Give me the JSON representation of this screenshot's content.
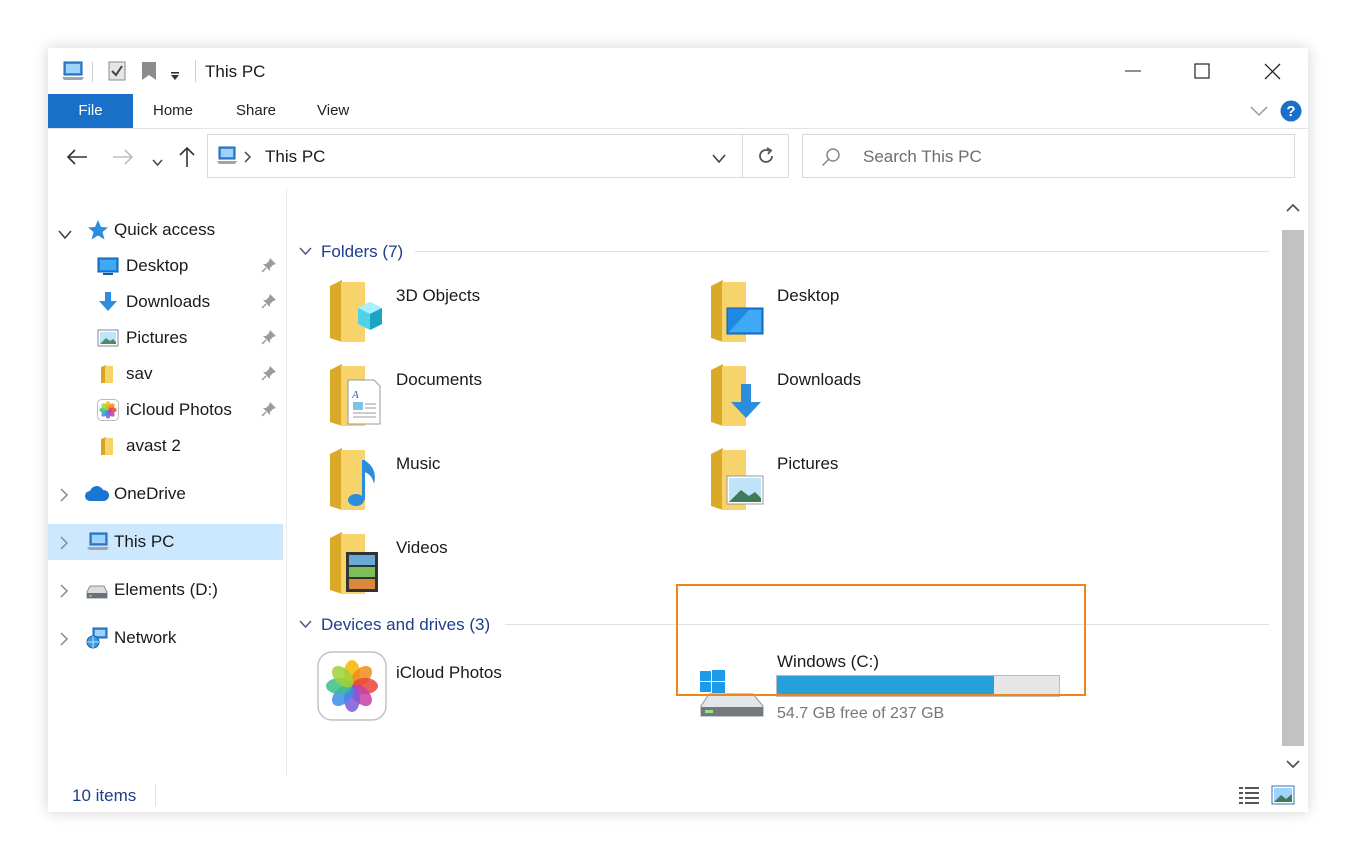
{
  "window": {
    "title": "This PC"
  },
  "ribbon": {
    "tabs": [
      "File",
      "Home",
      "Share",
      "View"
    ]
  },
  "address": {
    "path": "This PC",
    "search_placeholder": "Search This PC"
  },
  "sidebar": {
    "quick_access": "Quick access",
    "quick_items": [
      {
        "label": "Desktop",
        "icon": "desktop-icon",
        "pinned": true
      },
      {
        "label": "Downloads",
        "icon": "downloads-icon",
        "pinned": true
      },
      {
        "label": "Pictures",
        "icon": "pictures-icon",
        "pinned": true
      },
      {
        "label": "sav",
        "icon": "folder-icon",
        "pinned": true
      },
      {
        "label": "iCloud Photos",
        "icon": "icloud-photos-icon",
        "pinned": true
      },
      {
        "label": "avast 2",
        "icon": "folder-icon",
        "pinned": false
      }
    ],
    "onedrive": "OneDrive",
    "this_pc": "This PC",
    "elements": "Elements (D:)",
    "network": "Network"
  },
  "folders": {
    "header": "Folders (7)",
    "items": [
      "3D Objects",
      "Desktop",
      "Documents",
      "Downloads",
      "Music",
      "Pictures",
      "Videos"
    ]
  },
  "devices": {
    "header": "Devices and drives (3)",
    "icloud_label": "iCloud Photos",
    "drive_name": "Windows (C:)",
    "drive_space": "54.7 GB free of 237 GB",
    "drive_used_fraction": 0.77
  },
  "status": {
    "items_count": "10 items"
  },
  "colors": {
    "accent": "#1a6fc9",
    "highlight": "#f08519",
    "drive_bar": "#26a0da",
    "folder": "#f2c94c"
  }
}
